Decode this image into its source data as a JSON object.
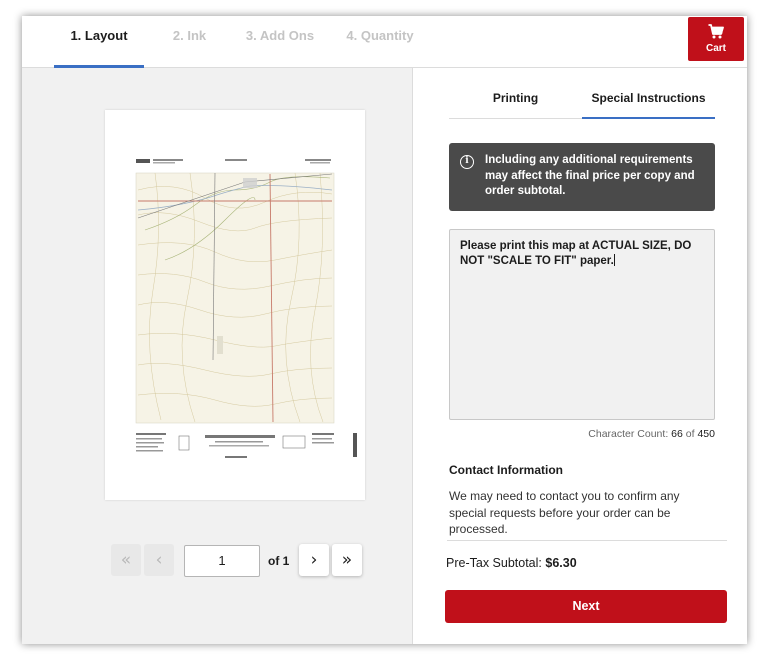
{
  "steps": [
    {
      "label": "1. Layout",
      "active": true
    },
    {
      "label": "2. Ink",
      "active": false
    },
    {
      "label": "3. Add Ons",
      "active": false
    },
    {
      "label": "4. Quantity",
      "active": false
    }
  ],
  "cart": {
    "label": "Cart",
    "icon": "cart-icon"
  },
  "pager": {
    "first_icon": "«",
    "prev_icon": "‹",
    "page_value": "1",
    "of_label": "of 1",
    "next_icon": "›",
    "last_icon": "»"
  },
  "tabs": [
    {
      "label": "Printing",
      "active": false
    },
    {
      "label": "Special Instructions",
      "active": true
    }
  ],
  "notice": {
    "icon": "info-icon",
    "text": "Including any additional requirements may affect the final price per copy and order subtotal."
  },
  "instructions": {
    "value": "Please print this map at ACTUAL SIZE, DO NOT \"SCALE TO FIT\" paper."
  },
  "char_count": {
    "label": "Character Count:",
    "current": "66",
    "of": "of",
    "max": "450"
  },
  "contact": {
    "title": "Contact Information",
    "body": "We may need to contact you to confirm any special requests before your order can be processed."
  },
  "subtotal": {
    "label": "Pre-Tax Subtotal:",
    "value": "$6.30"
  },
  "next_button": {
    "label": "Next"
  },
  "colors": {
    "accent_red": "#c0101a",
    "active_tab_blue": "#3a6fc4",
    "notice_bg": "#4a4a4a"
  }
}
